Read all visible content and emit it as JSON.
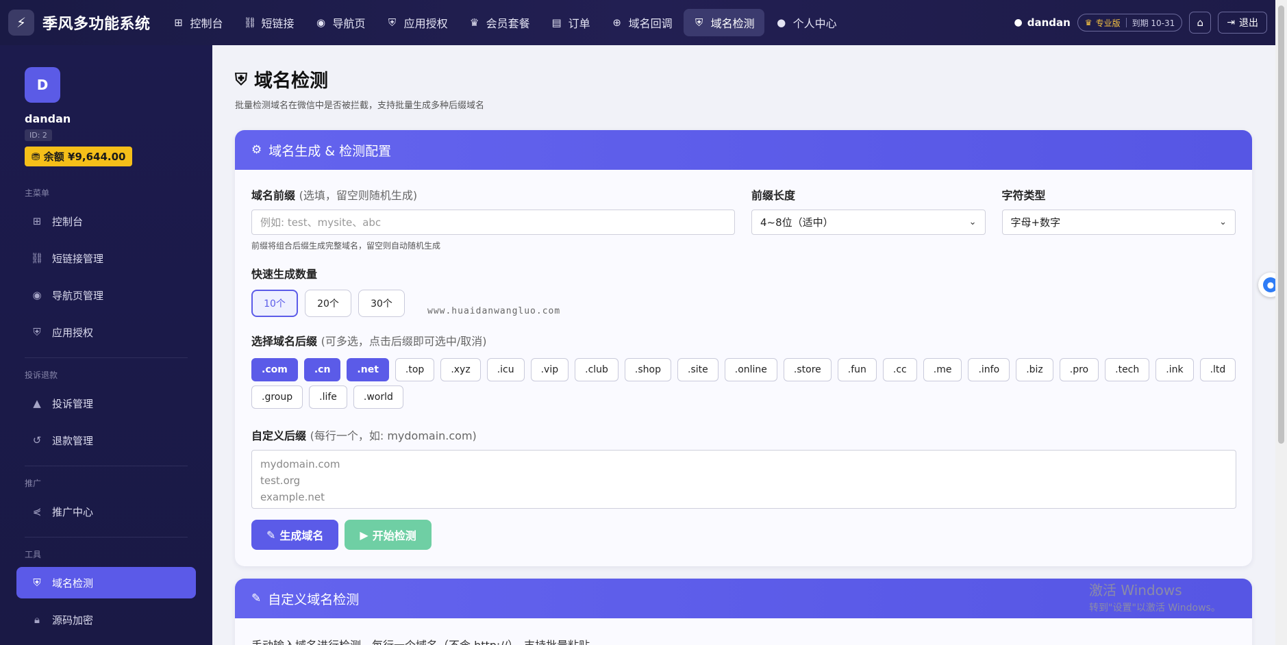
{
  "brand": {
    "name": "季风多功能系统",
    "logo_icon": "bolt-icon"
  },
  "nav": [
    {
      "label": "控制台",
      "icon": "grid-icon",
      "glyph": "⊞"
    },
    {
      "label": "短链接",
      "icon": "link-icon",
      "glyph": "🔗"
    },
    {
      "label": "导航页",
      "icon": "compass-icon",
      "glyph": "◉"
    },
    {
      "label": "应用授权",
      "icon": "shield-icon",
      "glyph": "⛨"
    },
    {
      "label": "会员套餐",
      "icon": "crown-icon",
      "glyph": "♛"
    },
    {
      "label": "订单",
      "icon": "receipt-icon",
      "glyph": "▤"
    },
    {
      "label": "域名回调",
      "icon": "globe-icon",
      "glyph": "⊕"
    },
    {
      "label": "域名检测",
      "icon": "shield-icon",
      "glyph": "⛨"
    },
    {
      "label": "个人中心",
      "icon": "user-icon",
      "glyph": "👤"
    }
  ],
  "top_right": {
    "username": "dandan",
    "plan": "专业版",
    "expiry": "到期 10-31",
    "logout": "退出"
  },
  "user": {
    "avatar_letter": "D",
    "name": "dandan",
    "id": "ID: 2",
    "balance": "余额 ¥9,644.00"
  },
  "sidebar": {
    "sections": [
      {
        "title": "主菜单",
        "items": [
          "控制台",
          "短链接管理",
          "导航页管理",
          "应用授权"
        ]
      },
      {
        "title": "投诉退款",
        "items": [
          "投诉管理",
          "退款管理"
        ]
      },
      {
        "title": "推广",
        "items": [
          "推广中心"
        ]
      },
      {
        "title": "工具",
        "items": [
          "域名检测",
          "源码加密"
        ]
      }
    ]
  },
  "page": {
    "title": "域名检测",
    "subtitle": "批量检测域名在微信中是否被拦截，支持批量生成多种后缀域名"
  },
  "config_card": {
    "title": "域名生成 & 检测配置",
    "prefix_label": "域名前缀",
    "prefix_hint": "(选填，留空则随机生成)",
    "prefix_placeholder": "例如: test、mysite、abc",
    "prefix_note": "前缀将组合后缀生成完整域名，留空则自动随机生成",
    "length_label": "前缀长度",
    "length_value": "4~8位（适中）",
    "chartype_label": "字符类型",
    "chartype_value": "字母+数字",
    "qty_label": "快速生成数量",
    "qty_options": [
      "10个",
      "20个",
      "30个"
    ],
    "qty_selected": "10个",
    "suffix_label": "选择域名后缀",
    "suffix_hint": "(可多选，点击后缀即可选中/取消)",
    "suffixes": [
      ".com",
      ".cn",
      ".net",
      ".top",
      ".xyz",
      ".icu",
      ".vip",
      ".club",
      ".shop",
      ".site",
      ".online",
      ".store",
      ".fun",
      ".cc",
      ".me",
      ".info",
      ".biz",
      ".pro",
      ".tech",
      ".ink",
      ".ltd",
      ".group",
      ".life",
      ".world"
    ],
    "suffixes_selected": [
      ".com",
      ".cn",
      ".net"
    ],
    "custom_label": "自定义后缀",
    "custom_hint": "(每行一个，如: mydomain.com)",
    "custom_placeholder_lines": [
      "mydomain.com",
      "test.org",
      "example.net"
    ],
    "btn_generate": "生成域名",
    "btn_check": "开始检测"
  },
  "custom_card": {
    "title": "自定义域名检测",
    "desc": "手动输入域名进行检测，每行一个域名（不含 http://），支持批量粘贴"
  },
  "watermark": "www.huaidanwangluo.com",
  "windows_activation": {
    "line1": "激活 Windows",
    "line2": "转到\"设置\"以激活 Windows。"
  },
  "colors": {
    "accent": "#5b5be8",
    "nav_bg": "#1a1a45",
    "balance": "#f5bf19",
    "check_btn": "#6fcfa4"
  }
}
